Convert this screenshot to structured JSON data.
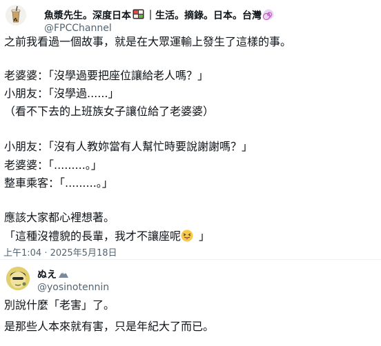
{
  "post1": {
    "display_name_parts": [
      "魚漿先生。深度日本",
      "｜生活。摘錄。日本。台灣"
    ],
    "handle": "@FPCChannel",
    "lines": [
      "之前我看過一個故事，就是在大眾運輸上發生了這樣的事。",
      "老婆婆：「沒學過要把座位讓給老人嗎？」",
      "小朋友：「沒學過......」",
      "（看不下去的上班族女子讓位給了老婆婆）",
      "小朋友：「沒有人教妳當有人幫忙時要說謝謝嗎？」",
      "老婆婆：「.........。」",
      "整車乘客：「.........。」",
      "應該大家都心裡想著。",
      "「這種沒禮貌的長輩，我才不讓座呢",
      "」"
    ],
    "timestamp": "上午1:04 · 2025年5月18日"
  },
  "post2": {
    "display_name": "ぬえ",
    "handle": "@yosinotennin",
    "lines": [
      "別說什麼「老害」了。",
      "是那些人本來就有害，只是年紀大了而已。"
    ]
  },
  "colors": {
    "text": "#0f1419",
    "secondary": "#536471",
    "divider": "#eff3f4"
  },
  "icons": [
    "bubble-tea-avatar",
    "bento-emoji",
    "spiral-emoji",
    "tongue-emoji",
    "cartoon-avatar",
    "mountain-emoji"
  ]
}
